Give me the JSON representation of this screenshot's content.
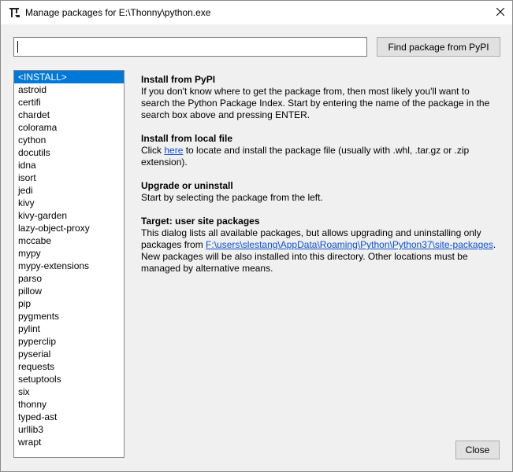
{
  "window": {
    "title": "Manage packages for E:\\Thonny\\python.exe",
    "close_glyph": "✕"
  },
  "search": {
    "value": "",
    "placeholder": ""
  },
  "buttons": {
    "find_label": "Find package from PyPI",
    "close_label": "Close"
  },
  "packages": [
    "<INSTALL>",
    "astroid",
    "certifi",
    "chardet",
    "colorama",
    "cython",
    "docutils",
    "idna",
    "isort",
    "jedi",
    "kivy",
    "kivy-garden",
    "lazy-object-proxy",
    "mccabe",
    "mypy",
    "mypy-extensions",
    "parso",
    "pillow",
    "pip",
    "pygments",
    "pylint",
    "pyperclip",
    "pyserial",
    "requests",
    "setuptools",
    "six",
    "thonny",
    "typed-ast",
    "urllib3",
    "wrapt"
  ],
  "selected_package": "<INSTALL>",
  "info": {
    "install_pypi": {
      "heading": "Install from PyPI",
      "text": "If you don't know where to get the package from, then most likely you'll want to search the Python Package Index. Start by entering the name of the package in the search box above and pressing ENTER."
    },
    "install_local": {
      "heading": "Install from local file",
      "text_before": "Click ",
      "link": "here",
      "text_after": " to locate and install the package file (usually with .whl, .tar.gz or .zip extension)."
    },
    "upgrade": {
      "heading": "Upgrade or uninstall",
      "text": "Start by selecting the package from the left."
    },
    "target": {
      "heading": "Target:  user site packages",
      "text_before": "This dialog lists all available packages, but allows upgrading and uninstalling only packages from ",
      "link": "F:\\users\\slestang\\AppData\\Roaming\\Python\\Python37\\site-packages",
      "text_after": ". New packages will be also installed into this directory. Other locations must be managed by alternative means."
    }
  },
  "colors": {
    "selection": "#0078d7",
    "link": "#0b4fd6"
  },
  "icons": {
    "app": "thonny-logo-icon",
    "close": "close-icon"
  }
}
